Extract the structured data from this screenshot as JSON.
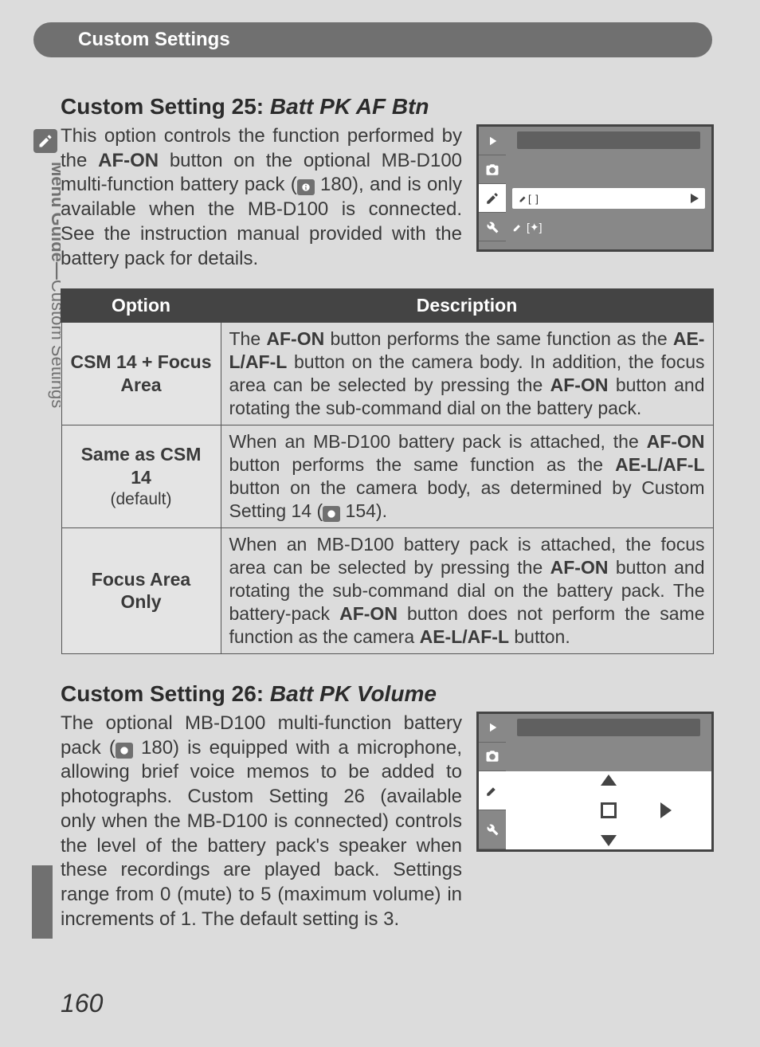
{
  "header": {
    "title": "Custom Settings"
  },
  "side_tab": {
    "line1": "Menu Guide—",
    "line2": "Custom Settings"
  },
  "setting25": {
    "heading_prefix": "Custom Setting 25: ",
    "heading_italic": "Batt PK AF Btn",
    "p_a": "This option controls the function performed by the ",
    "p_b_bold": "AF-ON",
    "p_c": " button on the optional MB-D100 multi-function battery pack (",
    "p_ref": " 180), and is only available when the MB-D100 is connected.  See the instruction manual provided with the battery pack for details.",
    "lcd_menu_text": "[ ]"
  },
  "table": {
    "h1": "Option",
    "h2": "Description",
    "rows": [
      {
        "name": "CSM 14 + Focus Area",
        "default": "",
        "d_a": "The ",
        "d_b": "AF-ON",
        "d_c": " button performs the same function as the ",
        "d_d": "AE-L/AF-L",
        "d_e": " button on the camera body.  In addition, the focus area can be selected by pressing the ",
        "d_f": "AF-ON",
        "d_g": " button and rotating the sub-command dial on the battery pack."
      },
      {
        "name": "Same as CSM 14",
        "default": "(default)",
        "d_a": "When an MB-D100 battery pack is attached, the ",
        "d_b": "AF-ON",
        "d_c": " button performs the same function as the ",
        "d_d": "AE-L/AF-L",
        "d_e": " button on the camera body, as determined by Custom Setting 14 (",
        "d_f": " 154)."
      },
      {
        "name": "Focus Area Only",
        "default": "",
        "d_a": "When an MB-D100 battery pack is attached, the focus area can be selected by pressing the ",
        "d_b": "AF-ON",
        "d_c": " button and rotating the sub-command dial on the battery pack.  The battery-pack ",
        "d_d": "AF-ON",
        "d_e": " button does not perform the same function as the camera ",
        "d_f": "AE-L/AF-L",
        "d_g": " button."
      }
    ]
  },
  "setting26": {
    "heading_prefix": "Custom Setting 26: ",
    "heading_italic": "Batt PK Volume",
    "p_a": "The optional MB-D100 multi-function battery pack (",
    "p_ref": " 180) is equipped with a microphone, allowing brief voice memos to be added to photographs.  Custom Setting 26 (available only when the MB-D100 is connected) controls the level of the battery pack's speaker when these recordings are played back.  Settings range from 0 (mute) to 5 (maximum volume) in increments of 1.  The default setting is 3."
  },
  "page_number": "160"
}
